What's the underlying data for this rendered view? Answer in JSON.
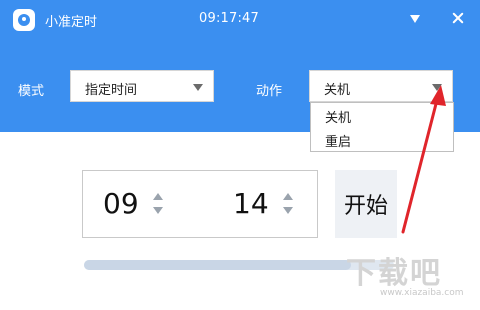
{
  "window": {
    "title": "小准定时",
    "clock": "09:17:47"
  },
  "settings": {
    "mode_label": "模式",
    "mode_value": "指定时间",
    "action_label": "动作",
    "action_value": "关机"
  },
  "action_dropdown": {
    "options": [
      "关机",
      "重启"
    ]
  },
  "timer": {
    "hour": "09",
    "minute": "14",
    "start_label": "开始",
    "progress_fraction": 0.86
  },
  "colors": {
    "accent": "#3b8ff0",
    "annotation_arrow": "#e0252b"
  },
  "watermark": {
    "text": "下载吧",
    "url": "www.xiazaiba.com"
  }
}
